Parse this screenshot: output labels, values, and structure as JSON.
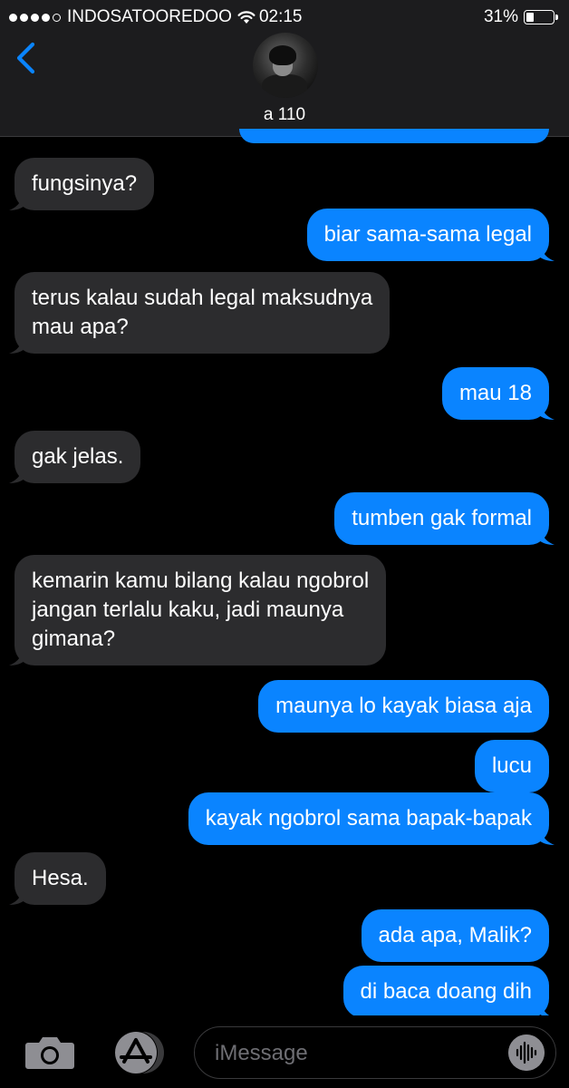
{
  "status_bar": {
    "carrier": "INDOSATOOREDOO",
    "time": "02:15",
    "battery_percent_label": "31%",
    "battery_level": 0.31,
    "signal_bars_filled": 4,
    "signal_bars_total": 5
  },
  "header": {
    "back_icon": "chevron-left-icon",
    "contact_name": "a 110"
  },
  "messages": [
    {
      "dir": "in",
      "text": "fungsinya?"
    },
    {
      "dir": "out",
      "text": "biar sama-sama legal"
    },
    {
      "dir": "in",
      "text": "terus kalau sudah legal maksudnya\nmau apa?"
    },
    {
      "dir": "out",
      "text": "mau 18"
    },
    {
      "dir": "in",
      "text": "gak jelas."
    },
    {
      "dir": "out",
      "text": "tumben gak formal"
    },
    {
      "dir": "in",
      "text": "kemarin kamu bilang kalau ngobrol\njangan terlalu kaku, jadi maunya\ngimana?"
    },
    {
      "dir": "out",
      "text": "maunya lo kayak biasa aja"
    },
    {
      "dir": "out",
      "text": "lucu"
    },
    {
      "dir": "out",
      "text": "kayak ngobrol sama bapak-bapak"
    },
    {
      "dir": "in",
      "text": "Hesa."
    },
    {
      "dir": "out",
      "text": "ada apa, Malik?"
    },
    {
      "dir": "out",
      "text": "di baca doang dih"
    }
  ],
  "input_bar": {
    "camera_icon": "camera-icon",
    "apps_icon": "app-store-icon",
    "placeholder": "iMessage",
    "audio_icon": "audio-waveform-icon"
  },
  "colors": {
    "outgoing_bubble": "#0a84ff",
    "incoming_bubble": "#2c2c2e",
    "back_chevron": "#0a84ff",
    "background": "#000000"
  }
}
